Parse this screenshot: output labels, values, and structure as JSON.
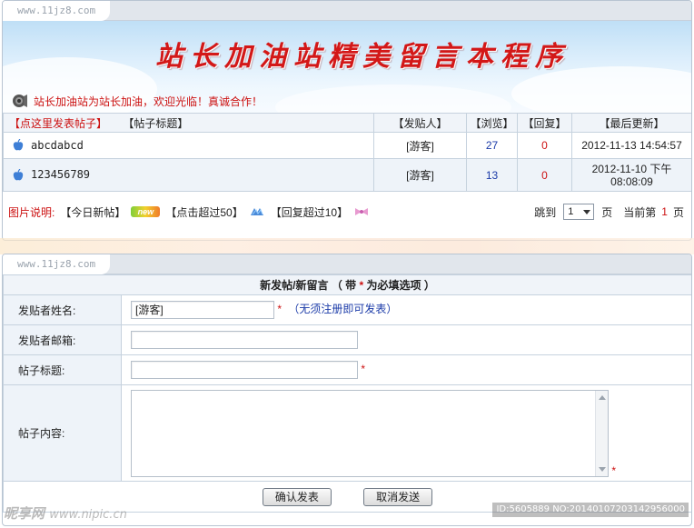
{
  "site_url": "www.11jz8.com",
  "banner": {
    "title": "站长加油站精美留言本程序",
    "welcome": "站长加油站为站长加油，欢迎光临！真诚合作！"
  },
  "list": {
    "header": {
      "post_link": "【点这里发表帖子】",
      "title": "【帖子标题】",
      "author": "【发贴人】",
      "views": "【浏览】",
      "replies": "【回复】",
      "updated": "【最后更新】"
    },
    "rows": [
      {
        "title": "abcdabcd",
        "author": "[游客]",
        "views": "27",
        "replies": "0",
        "updated_date": "2012-11-13 14:54:57",
        "updated_time": ""
      },
      {
        "title": "123456789",
        "author": "[游客]",
        "views": "13",
        "replies": "0",
        "updated_date": "2012-11-10 下午",
        "updated_time": "08:08:09"
      }
    ]
  },
  "legend": {
    "label": "图片说明:",
    "today": "【今日新帖】",
    "new_badge": "new",
    "hot": "【点击超过50】",
    "reply": "【回复超过10】"
  },
  "pager": {
    "jump": "跳到",
    "page_value": "1",
    "page_unit": "页",
    "current_label": "当前第",
    "current_page": "1",
    "current_unit": "页"
  },
  "form": {
    "heading_before": "新发帖/新留言 （ 带 ",
    "heading_star": "*",
    "heading_after": " 为必填选项 ）",
    "name_label": "发贴者姓名:",
    "name_value": "[游客]",
    "name_note": "（无须注册即可发表）",
    "email_label": "发贴者邮箱:",
    "email_value": "",
    "subject_label": "帖子标题:",
    "subject_value": "",
    "content_label": "帖子内容:",
    "star": "*",
    "submit": "确认发表",
    "cancel": "取消发送"
  },
  "watermarks": {
    "left_main": "昵享网",
    "left_url": "www.nipic.cn",
    "right": "ID:5605889 NO:20140107203142956000"
  },
  "colors": {
    "accent_red": "#cc1111",
    "link_blue": "#1a3aa8",
    "header_bg": "#f0f4f9",
    "row_alt_bg": "#eef3f9",
    "border": "#c6d2de"
  }
}
